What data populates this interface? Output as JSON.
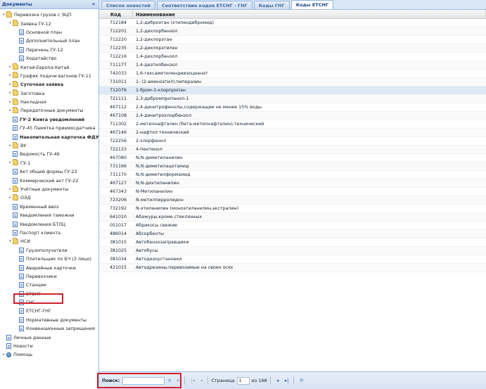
{
  "sidebar": {
    "title": "Документы",
    "collapse_icon": "«",
    "tree": [
      {
        "label": "Перевозка грузов с ЭЦП",
        "level": 0,
        "icon": "folder",
        "exp": "minus"
      },
      {
        "label": "Заявка ГУ-12",
        "level": 1,
        "icon": "folder",
        "exp": "minus"
      },
      {
        "label": "Основной план",
        "level": 2,
        "icon": "doc"
      },
      {
        "label": "Дополнительный план",
        "level": 2,
        "icon": "doc"
      },
      {
        "label": "Перечень ГУ-12",
        "level": 2,
        "icon": "doc"
      },
      {
        "label": "Ходатайство",
        "level": 2,
        "icon": "doc"
      },
      {
        "label": "Китай-Европа-Китай",
        "level": 1,
        "icon": "folder",
        "exp": "plus"
      },
      {
        "label": "График подачи вагонов ГУ-11",
        "level": 1,
        "icon": "folder",
        "exp": "plus"
      },
      {
        "label": "Суточная заявка",
        "level": 1,
        "icon": "folder",
        "exp": "plus",
        "bold": true
      },
      {
        "label": "Заготовка",
        "level": 1,
        "icon": "folder",
        "exp": "plus"
      },
      {
        "label": "Накладная",
        "level": 1,
        "icon": "folder",
        "exp": "plus"
      },
      {
        "label": "Передаточные документы",
        "level": 1,
        "icon": "folder",
        "exp": "plus"
      },
      {
        "label": "ГУ-2 Книга уведомлений",
        "level": 1,
        "icon": "doc",
        "bold": true
      },
      {
        "label": "ГУ-45 Памятка приемосдатчика",
        "level": 1,
        "icon": "doc"
      },
      {
        "label": "Накопительная карточка ФДУ-",
        "level": 1,
        "icon": "doc",
        "bold": true
      },
      {
        "label": "ВУ",
        "level": 1,
        "icon": "folder",
        "exp": "plus"
      },
      {
        "label": "Ведомость ГУ-46",
        "level": 1,
        "icon": "doc"
      },
      {
        "label": "ГУ-1",
        "level": 1,
        "icon": "folder",
        "exp": "plus"
      },
      {
        "label": "Акт общей формы ГУ-23",
        "level": 1,
        "icon": "doc"
      },
      {
        "label": "Коммерческий акт ГУ-22",
        "level": 1,
        "icon": "doc"
      },
      {
        "label": "Учётные документы",
        "level": 1,
        "icon": "folder",
        "exp": "plus"
      },
      {
        "label": "ОЭД",
        "level": 1,
        "icon": "folder",
        "exp": "plus"
      },
      {
        "label": "Временный ввоз",
        "level": 1,
        "icon": "doc"
      },
      {
        "label": "Уведомления таможни",
        "level": 1,
        "icon": "doc"
      },
      {
        "label": "Уведомления БТЛЦ",
        "level": 1,
        "icon": "doc"
      },
      {
        "label": "Паспорт клиента",
        "level": 1,
        "icon": "doc"
      },
      {
        "label": "НСИ",
        "level": 1,
        "icon": "folder",
        "exp": "minus"
      },
      {
        "label": "Грузополучатели",
        "level": 2,
        "icon": "doc"
      },
      {
        "label": "Плательщик по БЧ (3 лицо)",
        "level": 2,
        "icon": "doc"
      },
      {
        "label": "Аварийные карточки",
        "level": 2,
        "icon": "doc"
      },
      {
        "label": "Перевозчики",
        "level": 2,
        "icon": "doc"
      },
      {
        "label": "Станции",
        "level": 2,
        "icon": "doc"
      },
      {
        "label": "ЕТСНГ",
        "level": 2,
        "icon": "doc"
      },
      {
        "label": "ГНГ",
        "level": 2,
        "icon": "doc"
      },
      {
        "label": "ЕТСНГ-ГНГ",
        "level": 2,
        "icon": "doc"
      },
      {
        "label": "Нормативные документы",
        "level": 2,
        "icon": "doc"
      },
      {
        "label": "Конвенционные запрещения",
        "level": 2,
        "icon": "doc"
      },
      {
        "label": "Личные данные",
        "level": 0,
        "icon": "doc"
      },
      {
        "label": "Новости",
        "level": 0,
        "icon": "doc"
      },
      {
        "label": "Помощь",
        "level": 0,
        "icon": "globe",
        "exp": "plus"
      }
    ]
  },
  "tabs": [
    {
      "label": "Список новостей",
      "active": false
    },
    {
      "label": "Соответствие кодов ЕТСНГ - ГНГ",
      "active": false
    },
    {
      "label": "Коды ГНГ",
      "active": false
    },
    {
      "label": "Коды ЕТСНГ",
      "active": true
    }
  ],
  "grid": {
    "columns": {
      "code": "Код",
      "name": "Наименование"
    },
    "rows": [
      [
        "712184",
        "1,2-диброэтан (этилендибромид)"
      ],
      [
        "712201",
        "1,2-дихлорбензол"
      ],
      [
        "712220",
        "1,2-дихлорэтан"
      ],
      [
        "712235",
        "1,2-дихлорэтилен"
      ],
      [
        "712216",
        "1,4-дихлорбензол"
      ],
      [
        "711177",
        "1,4-диэтилбензол"
      ],
      [
        "742033",
        "1,6-гексаметилендиизоцианат"
      ],
      [
        "731011",
        "1- (2-аминоэтил),пиперазин"
      ],
      [
        "712076",
        "1-бром-3-хлорпропан"
      ],
      [
        "721111",
        "2,3-дибромпропанол-1"
      ],
      [
        "467112",
        "2,4-динитрофенолы,содержащие не менее 15% воды"
      ],
      [
        "467108",
        "2,4-динитрохлорбензол"
      ],
      [
        "711302",
        "2-метилнафталин (бета-метилнафталин),технический"
      ],
      [
        "467146",
        "2-нафтол технический"
      ],
      [
        "722256",
        "2-хлорфенол"
      ],
      [
        "722133",
        "4-пентенол"
      ],
      [
        "467080",
        "N,N-диметиланилин"
      ],
      [
        "731166",
        "N,N-диметилацетамид"
      ],
      [
        "731170",
        "N,N-диметилформамид"
      ],
      [
        "467127",
        "N,N-диэтиланилин"
      ],
      [
        "467343",
        "N-Метиланилин"
      ],
      [
        "723206",
        "N-метилпирролидон"
      ],
      [
        "732192",
        "N-этиланилин (моноэтиланилин,экстралин)"
      ],
      [
        "641010",
        "Абажуры,кроме стеклянных"
      ],
      [
        "051017",
        "Абрикосы свежие"
      ],
      [
        "486014",
        "Абсорбенты"
      ],
      [
        "381015",
        "Автобензозаправщики"
      ],
      [
        "381025",
        "Автобусы"
      ],
      [
        "381034",
        "Автодезоустановки"
      ],
      [
        "421015",
        "Автодрезины,перевозимые на своих осях"
      ]
    ],
    "selected_row": 8
  },
  "pager": {
    "search_label": "Поиск:",
    "search_value": "",
    "clear_icon": "×",
    "search_icon": "⌕",
    "first_icon": "|◂",
    "prev_icon": "◂",
    "page_label": "Страница",
    "page_value": "1",
    "of_label": "из 168",
    "next_icon": "▸",
    "last_icon": "▸|",
    "refresh_icon": "⟳"
  },
  "colors": {
    "accent": "#15428b",
    "highlight_box": "#d2202a",
    "header_bg": "#dae7f6"
  }
}
